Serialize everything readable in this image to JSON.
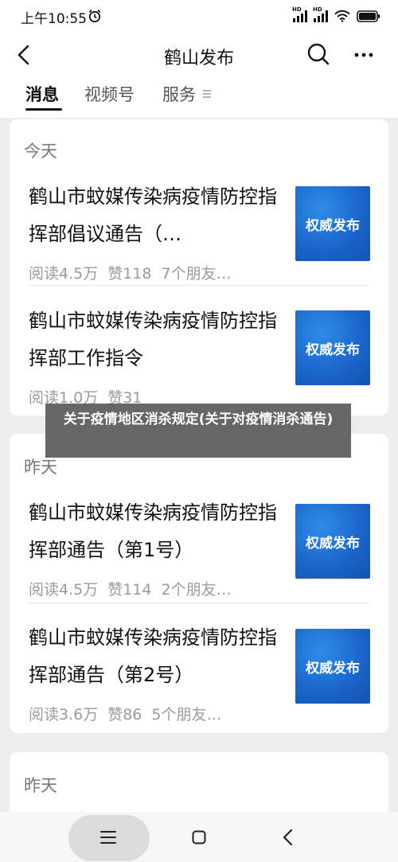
{
  "status_bar": {
    "time": "上午10:55",
    "hd_label": "HD"
  },
  "nav": {
    "title": "鹤山发布"
  },
  "tabs": [
    {
      "label": "消息",
      "active": true
    },
    {
      "label": "视频号",
      "active": false
    },
    {
      "label": "服务",
      "active": false
    }
  ],
  "groups": [
    {
      "date": "今天",
      "articles": [
        {
          "title": "鹤山市蚊媒传染病疫情防控指挥部倡议通告（…",
          "reads": "阅读4.5万",
          "likes": "赞118",
          "friends": "7个朋友…",
          "thumb": "权威发布"
        },
        {
          "title": "鹤山市蚊媒传染病疫情防控指挥部工作指令",
          "reads": "阅读1.0万",
          "likes": "赞31",
          "friends": "",
          "thumb": "权威发布"
        }
      ]
    },
    {
      "date": "昨天",
      "articles": [
        {
          "title": "鹤山市蚊媒传染病疫情防控指挥部通告（第1号）",
          "reads": "阅读4.5万",
          "likes": "赞114",
          "friends": "2个朋友…",
          "thumb": "权威发布"
        },
        {
          "title": "鹤山市蚊媒传染病疫情防控指挥部通告（第2号）",
          "reads": "阅读3.6万",
          "likes": "赞86",
          "friends": "5个朋友…",
          "thumb": "权威发布"
        }
      ]
    },
    {
      "date": "昨天",
      "articles": []
    }
  ],
  "overlay": {
    "text": "关于疫情地区消杀规定(关于对疫情消杀通告)"
  },
  "colors": {
    "thumb_blue": "#1a63c9",
    "background": "#ededed"
  }
}
